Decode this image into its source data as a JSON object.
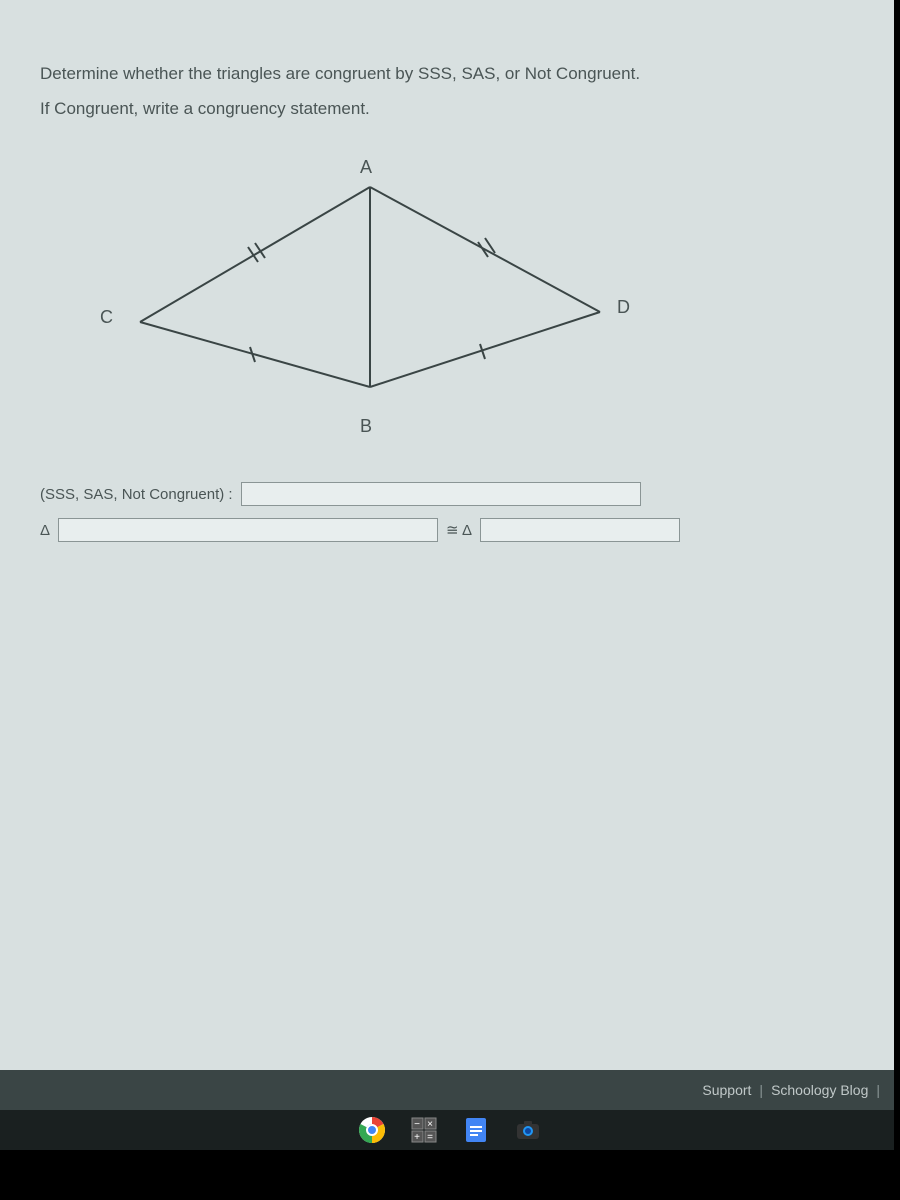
{
  "question": {
    "line1": "Determine whether the triangles are congruent by SSS, SAS, or Not Congruent.",
    "line2": "If Congruent, write a congruency statement."
  },
  "diagram": {
    "vertices": {
      "a": "A",
      "b": "B",
      "c": "C",
      "d": "D"
    }
  },
  "answers": {
    "congruence_label": "(SSS, SAS, Not Congruent) :",
    "triangle_symbol": "Δ",
    "congruent_symbol": "≅ Δ"
  },
  "footer": {
    "support": "Support",
    "blog": "Schoology Blog",
    "divider": "|"
  }
}
